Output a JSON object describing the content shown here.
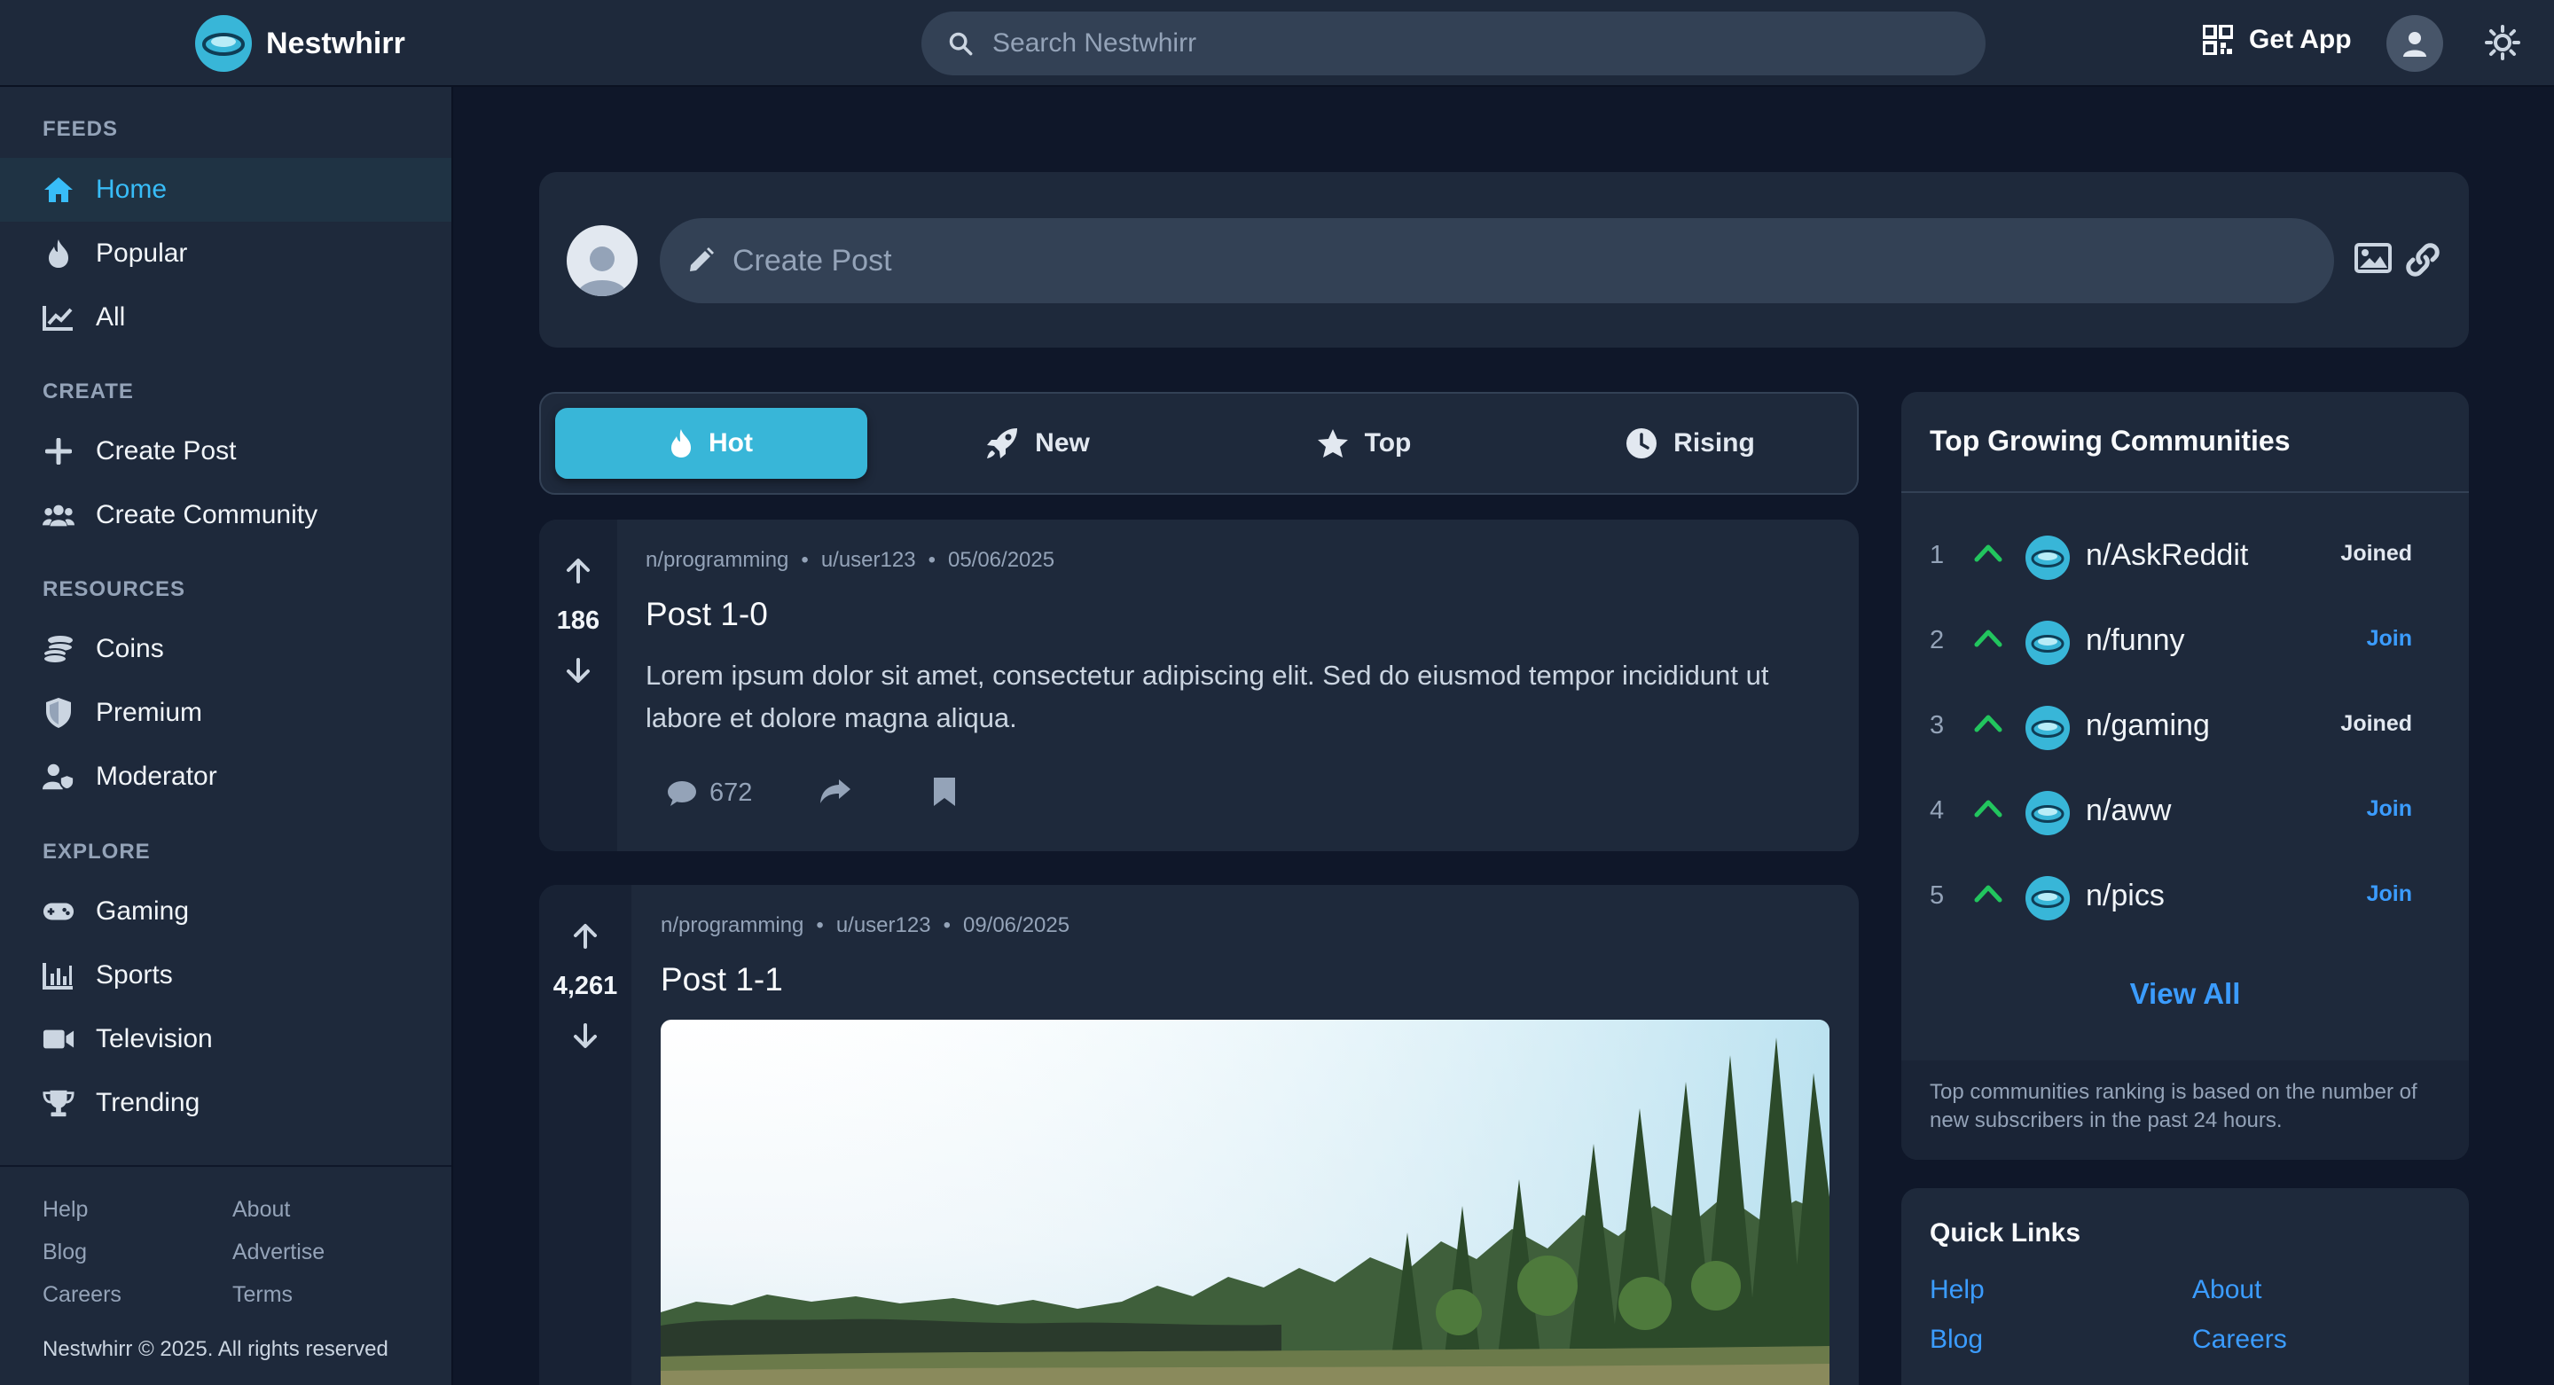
{
  "app": {
    "name": "Nestwhirr",
    "search_placeholder": "Search Nestwhirr",
    "get_app_label": "Get App"
  },
  "sidebar": {
    "sections": [
      {
        "heading": "FEEDS",
        "items": [
          {
            "label": "Home",
            "icon": "home-icon",
            "active": true
          },
          {
            "label": "Popular",
            "icon": "flame-icon"
          },
          {
            "label": "All",
            "icon": "chart-line-icon"
          }
        ]
      },
      {
        "heading": "CREATE",
        "items": [
          {
            "label": "Create Post",
            "icon": "plus-icon"
          },
          {
            "label": "Create Community",
            "icon": "users-icon"
          }
        ]
      },
      {
        "heading": "RESOURCES",
        "items": [
          {
            "label": "Coins",
            "icon": "coins-icon"
          },
          {
            "label": "Premium",
            "icon": "shield-icon"
          },
          {
            "label": "Moderator",
            "icon": "user-shield-icon"
          }
        ]
      },
      {
        "heading": "EXPLORE",
        "items": [
          {
            "label": "Gaming",
            "icon": "gamepad-icon"
          },
          {
            "label": "Sports",
            "icon": "bar-chart-icon"
          },
          {
            "label": "Television",
            "icon": "video-icon"
          },
          {
            "label": "Trending",
            "icon": "trophy-icon"
          }
        ]
      }
    ],
    "footer_links": [
      "Help",
      "About",
      "Blog",
      "Advertise",
      "Careers",
      "Terms"
    ],
    "copyright": "Nestwhirr © 2025. All rights reserved"
  },
  "create_post": {
    "placeholder": "Create Post"
  },
  "sort_tabs": [
    {
      "label": "Hot",
      "icon": "flame-icon",
      "active": true
    },
    {
      "label": "New",
      "icon": "rocket-icon"
    },
    {
      "label": "Top",
      "icon": "star-icon"
    },
    {
      "label": "Rising",
      "icon": "clock-icon"
    }
  ],
  "posts": [
    {
      "community": "n/programming",
      "author": "u/user123",
      "date": "05/06/2025",
      "votes": "186",
      "title": "Post 1-0",
      "body": "Lorem ipsum dolor sit amet, consectetur adipiscing elit. Sed do eiusmod tempor incididunt ut labore et dolore magna aliqua.",
      "comments": "672"
    },
    {
      "community": "n/programming",
      "author": "u/user123",
      "date": "09/06/2025",
      "votes": "4,261",
      "title": "Post 1-1"
    }
  ],
  "top_communities": {
    "title": "Top Growing Communities",
    "items": [
      {
        "rank": "1",
        "name": "n/AskReddit",
        "action": "Joined"
      },
      {
        "rank": "2",
        "name": "n/funny",
        "action": "Join"
      },
      {
        "rank": "3",
        "name": "n/gaming",
        "action": "Joined"
      },
      {
        "rank": "4",
        "name": "n/aww",
        "action": "Join"
      },
      {
        "rank": "5",
        "name": "n/pics",
        "action": "Join"
      }
    ],
    "view_all": "View All",
    "note": "Top communities ranking is based on the number of new subscribers in the past 24 hours."
  },
  "quick_links": {
    "title": "Quick Links",
    "links": [
      "Help",
      "About",
      "Blog",
      "Careers"
    ]
  },
  "colors": {
    "background": "#0f1729",
    "surface": "#1e293b",
    "accent": "#38b6d8",
    "link": "#3b9cff",
    "upvote_green": "#22c55e"
  }
}
